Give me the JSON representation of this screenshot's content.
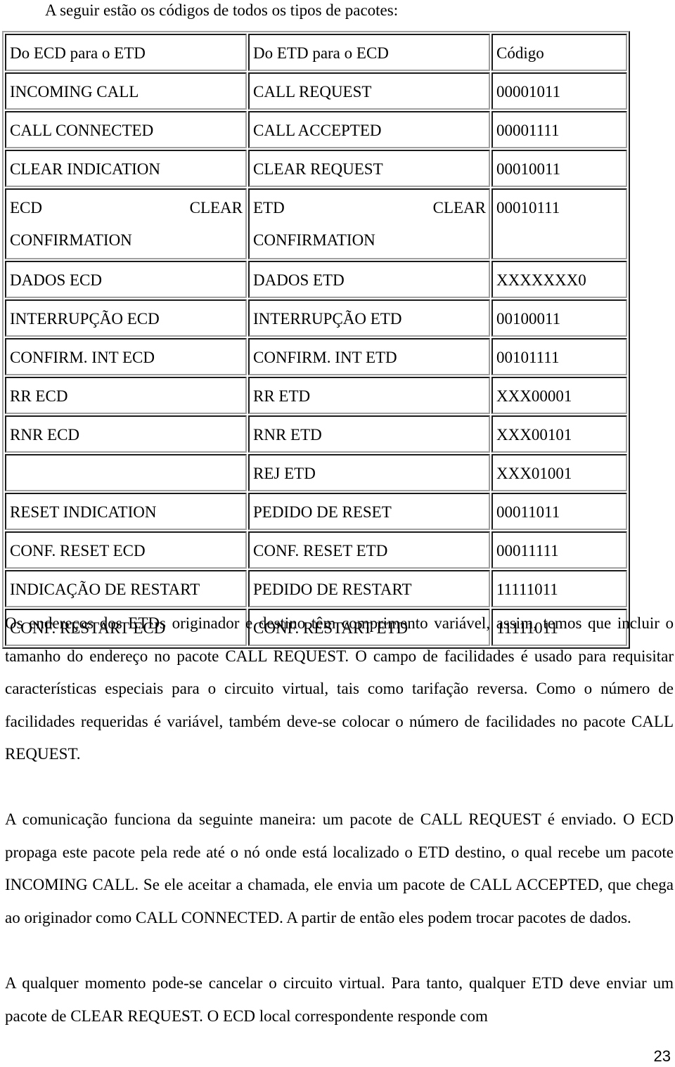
{
  "intro": "A seguir estão os códigos de todos os tipos de pacotes:",
  "table": {
    "headers": [
      "Do ECD para o ETD",
      "Do ETD para o ECD",
      "Código"
    ],
    "rows": [
      [
        "INCOMING CALL",
        "CALL REQUEST",
        "00001011"
      ],
      [
        "CALL CONNECTED",
        "CALL ACCEPTED",
        "00001111"
      ],
      [
        "CLEAR INDICATION",
        "CLEAR REQUEST",
        "00010011"
      ],
      [
        "ECD CLEAR CONFIRMATION",
        "ETD CLEAR CONFIRMATION",
        "00010111"
      ],
      [
        "DADOS ECD",
        "DADOS ETD",
        "XXXXXXX0"
      ],
      [
        "INTERRUPÇÃO ECD",
        "INTERRUPÇÃO ETD",
        "00100011"
      ],
      [
        "CONFIRM. INT ECD",
        "CONFIRM. INT ETD",
        "00101111"
      ],
      [
        "RR ECD",
        "RR ETD",
        "XXX00001"
      ],
      [
        "RNR ECD",
        "RNR ETD",
        "XXX00101"
      ],
      [
        "",
        "REJ ETD",
        "XXX01001"
      ],
      [
        "RESET INDICATION",
        "PEDIDO DE RESET",
        "00011011"
      ],
      [
        "CONF. RESET ECD",
        "CONF. RESET ETD",
        "00011111"
      ],
      [
        "INDICAÇÃO DE RESTART",
        "PEDIDO DE RESTART",
        "11111011"
      ],
      [
        "CONF. RESTART ECD",
        "CONF. RESTART ETD",
        "11111011"
      ]
    ],
    "split_row": {
      "c1_a": "ECD",
      "c1_b": "CLEAR",
      "c1_c": "CONFIRMATION",
      "c2_a": "ETD",
      "c2_b": "CLEAR",
      "c2_c": "CONFIRMATION"
    }
  },
  "paragraphs": [
    "Os endereços dos ETDs originador e destino têm comprimento variável, assim, temos que incluir o tamanho do endereço no pacote CALL REQUEST. O campo de facilidades é usado para requisitar características especiais para o circuito virtual, tais como tarifação reversa. Como o número de facilidades requeridas é variável, também deve-se colocar o número de facilidades no pacote CALL REQUEST.",
    "A comunicação funciona da seguinte maneira: um pacote de CALL REQUEST é enviado. O ECD propaga este pacote pela rede até o nó onde está localizado o ETD destino, o qual recebe um pacote INCOMING CALL. Se ele aceitar a chamada, ele envia um pacote de CALL ACCEPTED, que chega ao originador como CALL CONNECTED. A partir de então eles podem trocar pacotes de dados.",
    "A qualquer momento pode-se cancelar o circuito virtual. Para tanto, qualquer ETD deve enviar um pacote de CLEAR REQUEST. O ECD local correspondente responde com"
  ],
  "page_number": "23"
}
